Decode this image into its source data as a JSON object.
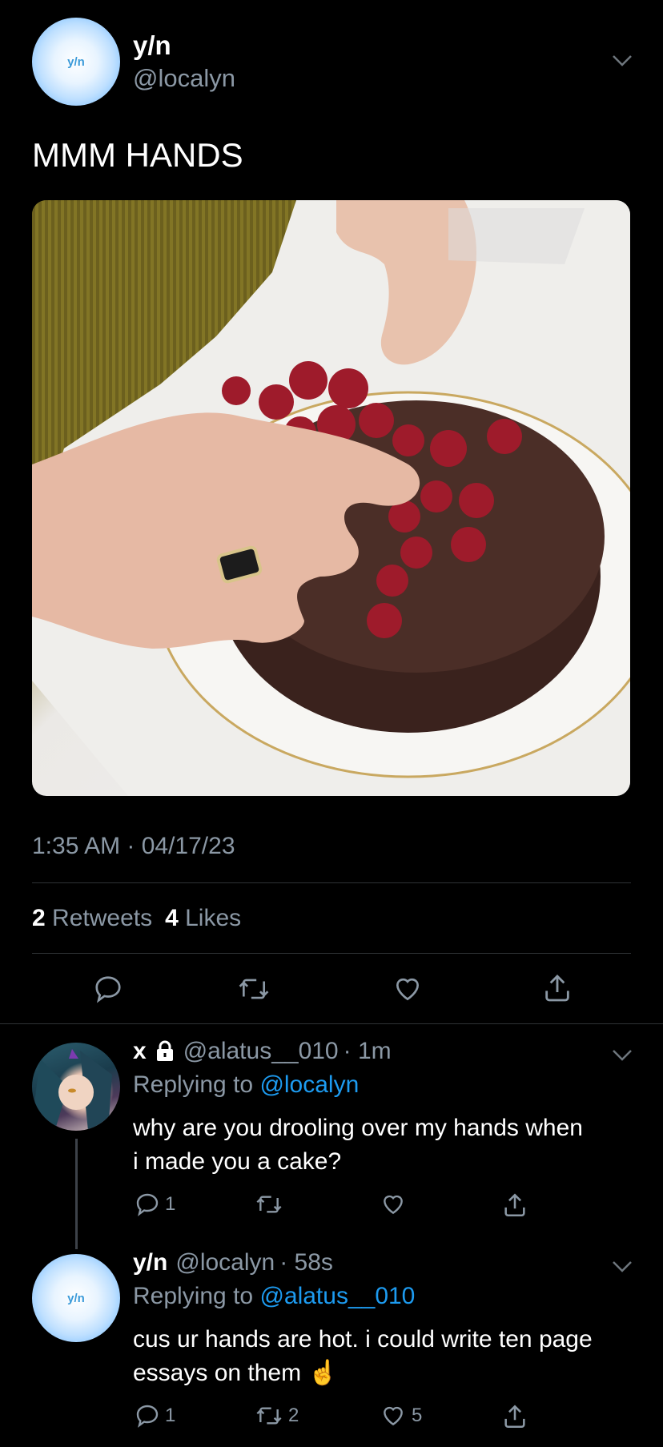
{
  "tweet": {
    "avatar_text": "y/n",
    "name": "y/n",
    "handle": "@localyn",
    "text": "MMM HANDS",
    "timestamp": "1:35 AM · 04/17/23",
    "retweets_count": "2",
    "retweets_label": "Retweets",
    "likes_count": "4",
    "likes_label": "Likes"
  },
  "replies": [
    {
      "name": "x",
      "handle": "@alatus__010",
      "time": "· 1m",
      "replying_prefix": "Replying to",
      "replying_to": "@localyn",
      "text": "why are you drooling over my hands when i made you a cake?",
      "reply_count": "1",
      "retweet_count": "",
      "like_count": ""
    },
    {
      "avatar_text": "y/n",
      "name": "y/n",
      "handle": "@localyn",
      "time": "· 58s",
      "replying_prefix": "Replying to",
      "replying_to": "@alatus__010",
      "text": "cus ur hands are hot. i could write ten page essays on them ☝️",
      "reply_count": "1",
      "retweet_count": "2",
      "like_count": "5"
    }
  ],
  "colors": {
    "background": "#000000",
    "accent": "#1d9bf0",
    "muted": "#8b98a5"
  }
}
